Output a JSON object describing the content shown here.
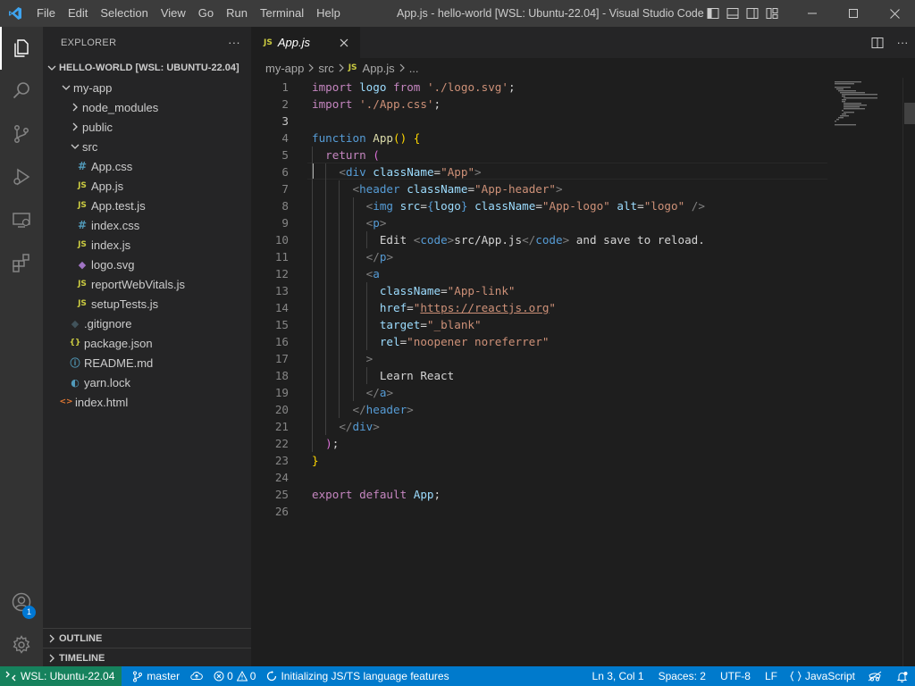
{
  "titlebar": {
    "menu": [
      "File",
      "Edit",
      "Selection",
      "View",
      "Go",
      "Run",
      "Terminal",
      "Help"
    ],
    "title": "App.js - hello-world [WSL: Ubuntu-22.04] - Visual Studio Code"
  },
  "activitybar": {
    "items": [
      "explorer-icon",
      "search-icon",
      "source-control-icon",
      "run-debug-icon",
      "remote-explorer-icon",
      "extensions-icon"
    ],
    "accounts_badge": "1"
  },
  "sidebar": {
    "title": "EXPLORER",
    "more": "···",
    "root": "HELLO-WORLD [WSL: UBUNTU-22.04]",
    "tree": [
      {
        "label": "my-app",
        "kind": "folder-open",
        "depth": 1
      },
      {
        "label": "node_modules",
        "kind": "folder",
        "depth": 2
      },
      {
        "label": "public",
        "kind": "folder",
        "depth": 2
      },
      {
        "label": "src",
        "kind": "folder-open",
        "depth": 2
      },
      {
        "label": "App.css",
        "kind": "css",
        "depth": 3
      },
      {
        "label": "App.js",
        "kind": "js",
        "depth": 3
      },
      {
        "label": "App.test.js",
        "kind": "js",
        "depth": 3
      },
      {
        "label": "index.css",
        "kind": "css",
        "depth": 3
      },
      {
        "label": "index.js",
        "kind": "js",
        "depth": 3
      },
      {
        "label": "logo.svg",
        "kind": "svg",
        "depth": 3
      },
      {
        "label": "reportWebVitals.js",
        "kind": "js",
        "depth": 3
      },
      {
        "label": "setupTests.js",
        "kind": "js",
        "depth": 3
      },
      {
        "label": ".gitignore",
        "kind": "git",
        "depth": 2
      },
      {
        "label": "package.json",
        "kind": "json",
        "depth": 2
      },
      {
        "label": "README.md",
        "kind": "info",
        "depth": 2
      },
      {
        "label": "yarn.lock",
        "kind": "yarn",
        "depth": 2
      },
      {
        "label": "index.html",
        "kind": "html",
        "depth": 1
      }
    ],
    "outline": "OUTLINE",
    "timeline": "TIMELINE"
  },
  "editor": {
    "tab": {
      "icon": "JS",
      "label": "App.js"
    },
    "breadcrumb": [
      "my-app",
      "src",
      "App.js",
      "..."
    ],
    "cursor_line": 3,
    "line_count": 26
  },
  "statusbar": {
    "remote": "WSL: Ubuntu-22.04",
    "branch": "master",
    "errors": "0",
    "warnings": "0",
    "progress": "Initializing JS/TS language features",
    "position": "Ln 3, Col 1",
    "spaces": "Spaces: 2",
    "encoding": "UTF-8",
    "eol": "LF",
    "language": "JavaScript"
  },
  "colors": {
    "titlebar": "#3c3c3c",
    "activitybar": "#333333",
    "sidebar": "#252526",
    "editor": "#1e1e1e",
    "statusbar": "#007acc",
    "remote": "#16825d"
  }
}
